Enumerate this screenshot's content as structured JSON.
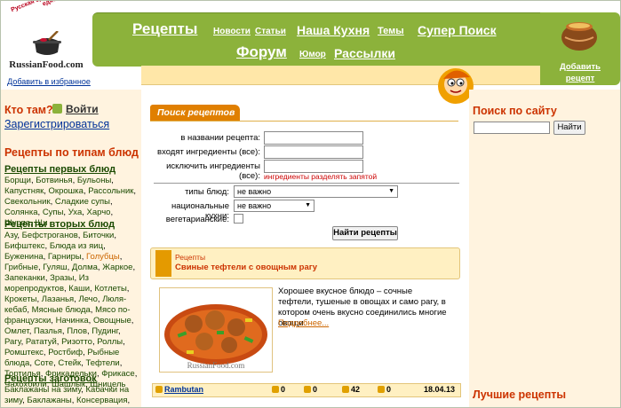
{
  "header": {
    "logo_slogan": "Русская еда - это всё, что едят!",
    "logo_text": "RussianFood.com",
    "add_to_favorites": "Добавить в избранное",
    "nav": [
      {
        "label": "Рецепты"
      },
      {
        "label": "Новости"
      },
      {
        "label": "Статьи"
      },
      {
        "label": "Наша Кухня"
      },
      {
        "label": "Темы"
      },
      {
        "label": "Супер Поиск"
      },
      {
        "label": "Форум"
      },
      {
        "label": "Юмор"
      },
      {
        "label": "Рассылки"
      }
    ],
    "add_recipe": "Добавить рецепт"
  },
  "sidebar": {
    "who": "Кто там?",
    "login": "Войти",
    "register": "Зарегистрироваться",
    "types_title": "Рецепты по типам блюд",
    "categories": [
      {
        "title": "Рецепты первых блюд",
        "items": [
          "Борщи",
          "Ботвинья",
          "Бульоны",
          "Капустняк",
          "Окрошка",
          "Рассольник",
          "Свекольник",
          "Сладкие супы",
          "Солянка",
          "Супы",
          "Уха",
          "Харчо",
          "Шурпа",
          "Щи"
        ]
      },
      {
        "title": "Рецепты вторых блюд",
        "items": [
          "Азу",
          "Бефстроганов",
          "Биточки",
          "Бифштекс",
          "Блюда из яиц",
          "Буженина",
          "Гарниры",
          "Голубцы",
          "Грибные",
          "Гуляш",
          "Долма",
          "Жаркое",
          "Запеканки",
          "Зразы",
          "Из морепродуктов",
          "Каши",
          "Котлеты",
          "Крокеты",
          "Лазанья",
          "Лечо",
          "Люля-кебаб",
          "Мясные блюда",
          "Мясо по-французски",
          "Начинка",
          "Овощные",
          "Омлет",
          "Пазлья",
          "Плов",
          "Пудинг",
          "Рагу",
          "Рататуй",
          "Ризотто",
          "Роллы",
          "Ромштекс",
          "Ростбиф",
          "Рыбные блюда",
          "Соте",
          "Стейк",
          "Тефтели",
          "Тортилья",
          "Фрикадельки",
          "Фрикасе",
          "Чахохбили",
          "Шашлык",
          "Шницель"
        ]
      },
      {
        "title": "Рецепты заготовок",
        "items": [
          "Баклажаны на зиму",
          "Кабачки на зиму",
          "Баклажаны",
          "Консервация",
          "Моченые"
        ]
      }
    ]
  },
  "search": {
    "tab": "Поиск рецептов",
    "label_name": "в названии рецепта:",
    "label_include": "входят ингредиенты (все):",
    "label_exclude": "исключить ингредиенты (все):",
    "hint": "ингредиенты разделять запятой",
    "label_types": "типы блюд:",
    "types_value": "не важно",
    "label_cuisine": "национальные кухни:",
    "cuisine_value": "не важно",
    "label_veg": "вегетарианские:",
    "submit": "Найти рецепты"
  },
  "recipe": {
    "category": "Рецепты",
    "title": "Свиные тефтели с овощным рагу",
    "photo_watermark": "RussianFood.com",
    "description": "Хорошее вкусное блюдо – сочные тефтели, тушеные в овощах и само рагу, в котором очень вкусно соединились многие овощи.",
    "more": "Подробнее...",
    "author": "Rambutan",
    "count1": "0",
    "count2": "0",
    "count3": "42",
    "count4": "0",
    "date": "18.04.13"
  },
  "right": {
    "site_search_title": "Поиск по сайту",
    "search_button": "Найти",
    "best_title": "Лучшие рецепты"
  },
  "colors": {
    "green": "#8cb23b",
    "orange": "#e07f00",
    "cream": "#fff3df",
    "red_heading": "#cc3300"
  }
}
